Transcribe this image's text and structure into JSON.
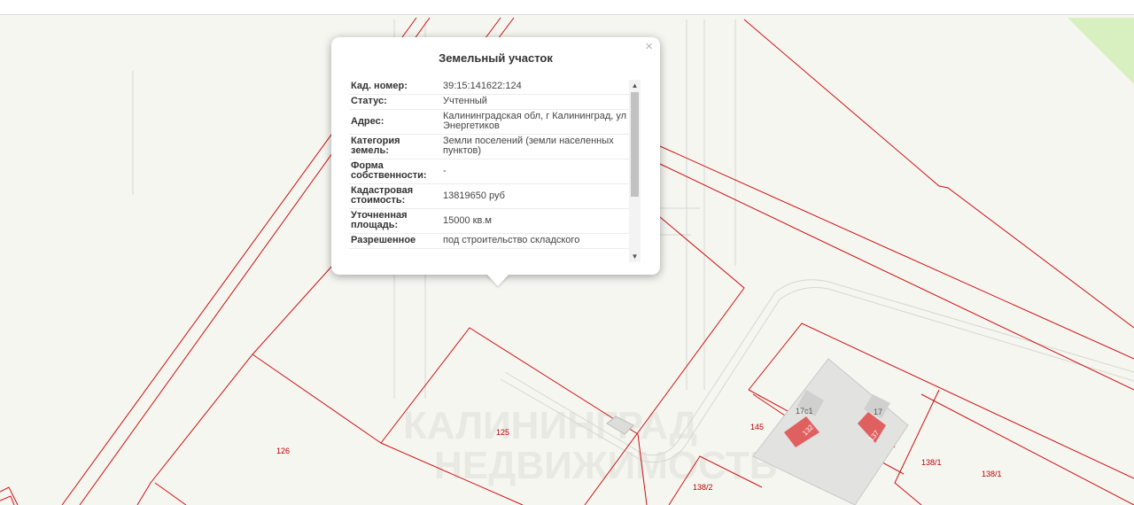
{
  "popup": {
    "title": "Земельный участок",
    "close_glyph": "×",
    "rows": [
      {
        "k": "Кад. номер:",
        "v": "39:15:141622:124"
      },
      {
        "k": "Статус:",
        "v": "Учтенный"
      },
      {
        "k": "Адрес:",
        "v": "Калининградская обл, г Калининград, ул Энергетиков"
      },
      {
        "k": "Категория земель:",
        "v": "Земли поселений (земли населенных пунктов)"
      },
      {
        "k": "Форма собственности:",
        "v": "-"
      },
      {
        "k": "Кадастровая стоимость:",
        "v": "13819650 руб"
      },
      {
        "k": "Уточненная площадь:",
        "v": "15000 кв.м"
      },
      {
        "k": "Разрешенное",
        "v": "под строительство складского"
      }
    ],
    "scroll_up": "▲",
    "scroll_down": "▼"
  },
  "map": {
    "parcel_labels": [
      "126",
      "125",
      "145",
      "17с1",
      "17",
      "138/1",
      "138/1",
      "138/2",
      "132",
      "137"
    ],
    "watermark": [
      "КАЛИНИНГРАД",
      "НЕДВИЖИМОСТЬ"
    ],
    "colors": {
      "boundary": "#cc1111",
      "building": "#e0e0e0",
      "highlight": "#e06060",
      "green": "#d8f0c0"
    }
  }
}
